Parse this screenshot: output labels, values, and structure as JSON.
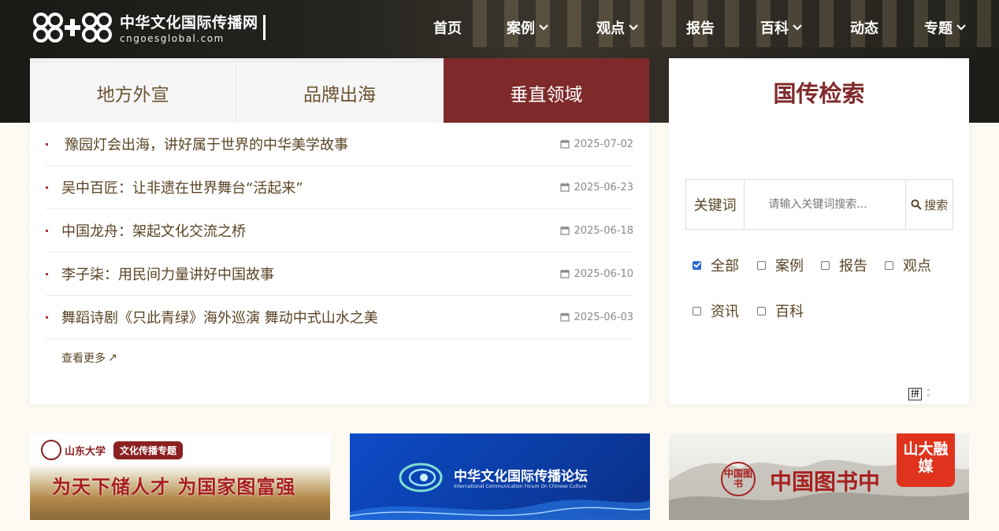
{
  "site": {
    "title": "中华文化国际传播网",
    "subtitle": "cngoesglobal.com"
  },
  "nav": {
    "items": [
      {
        "label": "首页",
        "dropdown": false
      },
      {
        "label": "案例",
        "dropdown": true
      },
      {
        "label": "观点",
        "dropdown": true
      },
      {
        "label": "报告",
        "dropdown": false
      },
      {
        "label": "百科",
        "dropdown": true
      },
      {
        "label": "动态",
        "dropdown": false
      },
      {
        "label": "专题",
        "dropdown": true
      }
    ]
  },
  "tabs": [
    {
      "label": "地方外宣",
      "active": false
    },
    {
      "label": "品牌出海",
      "active": false
    },
    {
      "label": "垂直领域",
      "active": true
    }
  ],
  "news": [
    {
      "title": "豫园灯会出海，讲好属于世界的中华美学故事",
      "date": "2025-07-02"
    },
    {
      "title": "吴中百匠：让非遗在世界舞台“活起来”",
      "date": "2025-06-23"
    },
    {
      "title": "中国龙舟：架起文化交流之桥",
      "date": "2025-06-18"
    },
    {
      "title": "李子柒：用民间力量讲好中国故事",
      "date": "2025-06-10"
    },
    {
      "title": "舞蹈诗剧《只此青绿》海外巡演 舞动中式山水之美",
      "date": "2025-06-03"
    }
  ],
  "more_label": "查看更多",
  "search": {
    "title": "国传检索",
    "label": "关键词",
    "placeholder": "请输入关键词搜索...",
    "button": "搜索"
  },
  "filters": [
    {
      "label": "全部",
      "checked": true
    },
    {
      "label": "案例",
      "checked": false
    },
    {
      "label": "报告",
      "checked": false
    },
    {
      "label": "观点",
      "checked": false
    },
    {
      "label": "资讯",
      "checked": false
    },
    {
      "label": "百科",
      "checked": false
    }
  ],
  "ime_label": "拼",
  "banners": {
    "b1": {
      "university": "山东大学",
      "tag": "文化传播专题",
      "slogan": "为天下储人才  为国家图富强"
    },
    "b2": {
      "title": "中华文化国际传播论坛",
      "subtitle": "International Communication Forum On Chinese Culture"
    },
    "b3": {
      "seal": "中国图书",
      "title": "中国图书中",
      "badge": "山大融媒"
    }
  },
  "colors": {
    "accent": "#7f2a2a",
    "text_brown": "#5a4424",
    "checkbox_blue": "#2a6ad5"
  }
}
